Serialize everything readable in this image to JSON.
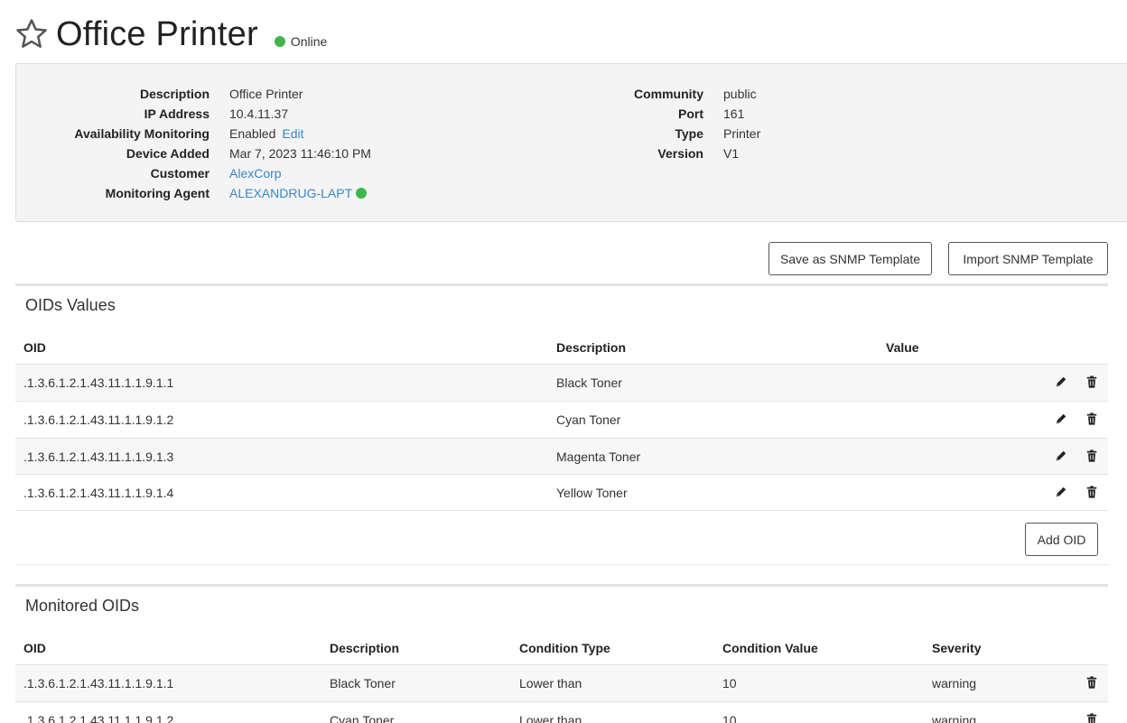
{
  "header": {
    "title": "Office Printer",
    "status": "Online",
    "status_color": "#3fb54a"
  },
  "info": {
    "left": [
      {
        "label": "Description",
        "value": "Office Printer"
      },
      {
        "label": "IP Address",
        "value": "10.4.11.37"
      },
      {
        "label": "Availability Monitoring",
        "value": "Enabled",
        "link": "Edit"
      },
      {
        "label": "Device Added",
        "value": "Mar 7, 2023 11:46:10 PM"
      },
      {
        "label": "Customer",
        "value": "AlexCorp"
      },
      {
        "label": "Monitoring Agent",
        "value": "ALEXANDRUG-LAPT"
      }
    ],
    "right": [
      {
        "label": "Community",
        "value": "public"
      },
      {
        "label": "Port",
        "value": "161"
      },
      {
        "label": "Type",
        "value": "Printer"
      },
      {
        "label": "Version",
        "value": "V1"
      }
    ]
  },
  "actions": {
    "save_template": "Save as SNMP Template",
    "import_template": "Import SNMP Template"
  },
  "oids_section": {
    "title": "OIDs Values",
    "columns": [
      "OID",
      "Description",
      "Value"
    ],
    "rows": [
      {
        "oid": ".1.3.6.1.2.1.43.11.1.1.9.1.1",
        "description": "Black Toner",
        "value": ""
      },
      {
        "oid": ".1.3.6.1.2.1.43.11.1.1.9.1.2",
        "description": "Cyan Toner",
        "value": ""
      },
      {
        "oid": ".1.3.6.1.2.1.43.11.1.1.9.1.3",
        "description": "Magenta Toner",
        "value": ""
      },
      {
        "oid": ".1.3.6.1.2.1.43.11.1.1.9.1.4",
        "description": "Yellow Toner",
        "value": ""
      }
    ],
    "add_label": "Add OID"
  },
  "monitored_section": {
    "title": "Monitored OIDs",
    "columns": [
      "OID",
      "Description",
      "Condition Type",
      "Condition Value",
      "Severity"
    ],
    "rows": [
      {
        "oid": ".1.3.6.1.2.1.43.11.1.1.9.1.1",
        "description": "Black Toner",
        "condition_type": "Lower than",
        "condition_value": "10",
        "severity": "warning"
      },
      {
        "oid": ".1.3.6.1.2.1.43.11.1.1.9.1.2",
        "description": "Cyan Toner",
        "condition_type": "Lower than",
        "condition_value": "10",
        "severity": "warning"
      }
    ]
  },
  "icons": {
    "favorite": "star-icon",
    "edit": "pencil-icon",
    "delete": "trash-icon"
  },
  "colors": {
    "link": "#3a86c8",
    "online": "#3fb54a"
  }
}
